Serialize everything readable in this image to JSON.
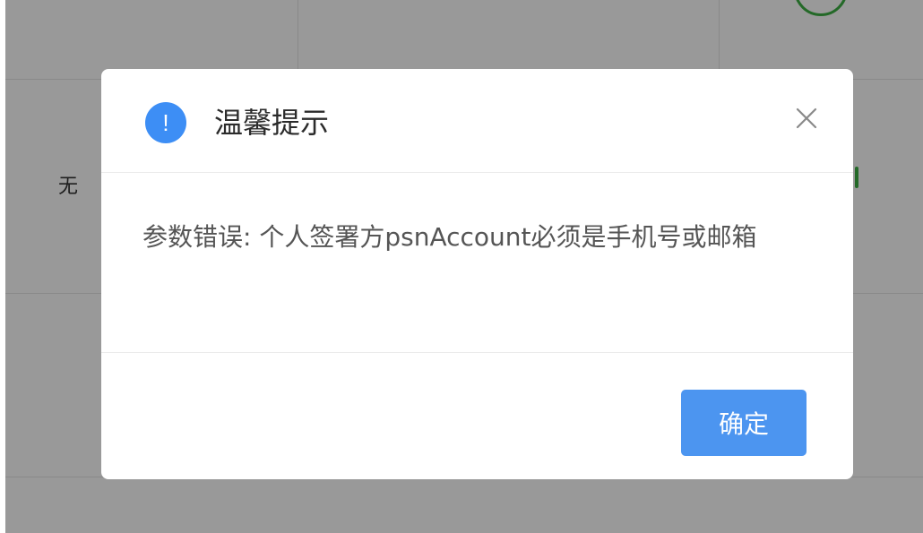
{
  "background": {
    "cell_text": "无"
  },
  "dialog": {
    "icon": "info-exclamation-icon",
    "icon_glyph": "!",
    "title": "温馨提示",
    "close_icon": "close-icon",
    "message": "参数错误: 个人签署方psnAccount必须是手机号或邮箱",
    "confirm_label": "确定"
  },
  "colors": {
    "accent": "#4c95f0",
    "icon": "#3d8ef5",
    "status_green": "#3cb043"
  }
}
